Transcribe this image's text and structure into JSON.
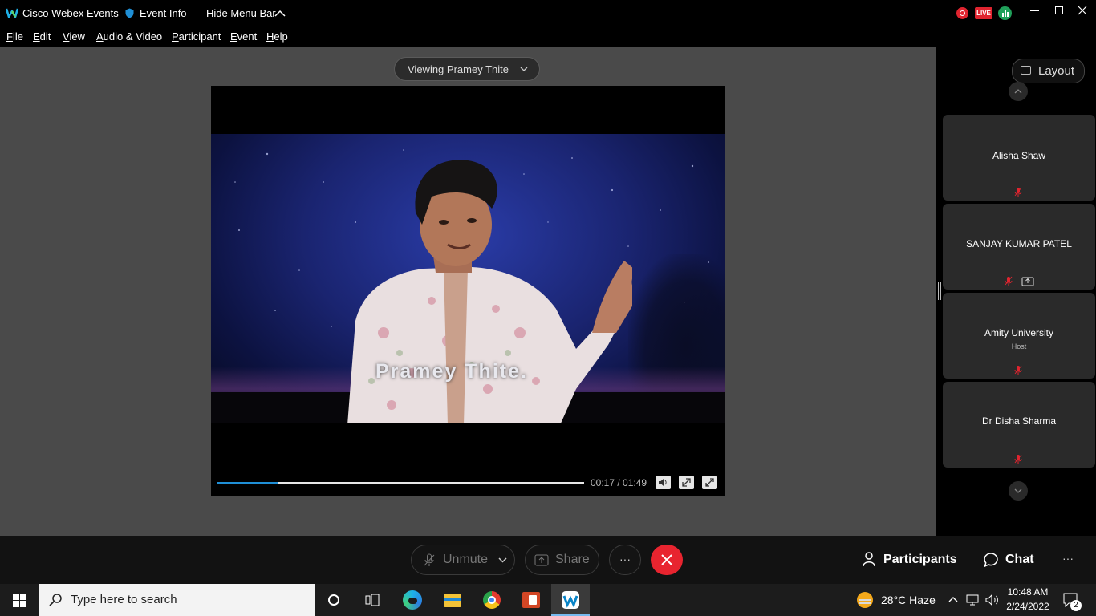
{
  "titlebar": {
    "app_title": "Cisco Webex Events",
    "event_info": "Event Info",
    "hide_menu": "Hide Menu Bar",
    "live_badge": "LIVE"
  },
  "menu": {
    "items": [
      "File",
      "Edit",
      "View",
      "Audio & Video",
      "Participant",
      "Event",
      "Help"
    ]
  },
  "stage": {
    "viewing_label": "Viewing Pramey Thite",
    "video_caption": "Pramey Thite.",
    "time_current": "00:17",
    "time_total": "01:49",
    "time_display": "00:17 / 01:49",
    "progress_fraction": 0.165
  },
  "rightpanel": {
    "layout_label": "Layout",
    "participants": [
      {
        "name": "Alisha Shaw",
        "role": ""
      },
      {
        "name": "SANJAY KUMAR PATEL",
        "role": ""
      },
      {
        "name": "Amity University",
        "role": "Host"
      },
      {
        "name": "Dr Disha Sharma",
        "role": ""
      }
    ]
  },
  "bottombar": {
    "unmute_label": "Unmute",
    "share_label": "Share",
    "more_label": "···",
    "participants_label": "Participants",
    "chat_label": "Chat",
    "overflow_label": "···"
  },
  "taskbar": {
    "search_placeholder": "Type here to search",
    "weather": "28°C  Haze",
    "time": "10:48 AM",
    "date": "2/24/2022",
    "notification_count": "2"
  },
  "colors": {
    "accent_blue": "#1f8fd6",
    "end_call_red": "#e8242f",
    "stage_gray": "#4a4a4a",
    "mic_red": "#e0242f"
  }
}
